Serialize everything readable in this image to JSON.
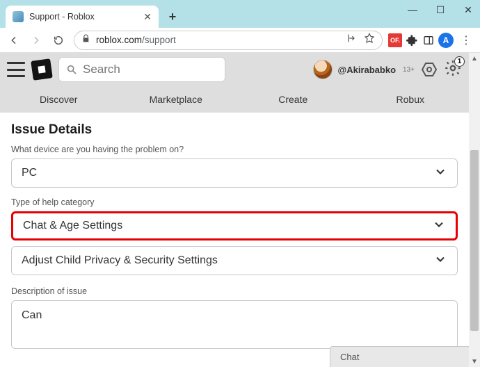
{
  "window": {
    "tab_title": "Support - Roblox",
    "url_host": "roblox.com",
    "url_path": "/support",
    "avatar_letter": "A"
  },
  "header": {
    "search_placeholder": "Search",
    "username": "@Akirababko",
    "age_flag": "13+",
    "notif_count": "1",
    "nav": [
      "Discover",
      "Marketplace",
      "Create",
      "Robux"
    ]
  },
  "form": {
    "section_title": "Issue Details",
    "device_label": "What device are you having the problem on?",
    "device_value": "PC",
    "help_label": "Type of help category",
    "help_value": "Chat & Age Settings",
    "sub_value": "Adjust Child Privacy & Security Settings",
    "desc_label": "Description of issue",
    "desc_value": "Can"
  },
  "chat": {
    "label": "Chat"
  },
  "ext": {
    "red_label": "OF."
  }
}
